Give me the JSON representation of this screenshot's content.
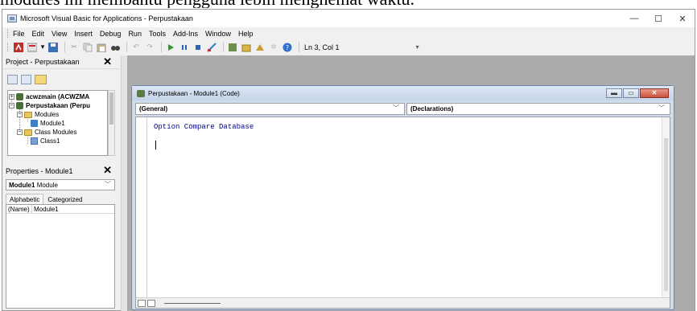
{
  "caption": "modules ini membantu pengguna lebih menghemat waktu.",
  "window": {
    "title": "Microsoft Visual Basic for Applications - Perpustakaan",
    "controls": {
      "minimize": "—",
      "maximize": "☐",
      "close": "✕"
    }
  },
  "menubar": {
    "items": [
      "File",
      "Edit",
      "View",
      "Insert",
      "Debug",
      "Run",
      "Tools",
      "Add-Ins",
      "Window",
      "Help"
    ]
  },
  "toolbar": {
    "position": "Ln 3, Col 1"
  },
  "project_panel": {
    "title": "Project - Perpustakaan",
    "close": "✕",
    "tree": [
      {
        "label": "acwzmain (ACWZMA",
        "bold": true
      },
      {
        "label": "Perpustakaan (Perpu",
        "bold": true
      },
      {
        "label": "Modules"
      },
      {
        "label": "Module1"
      },
      {
        "label": "Class Modules"
      },
      {
        "label": "Class1"
      }
    ]
  },
  "properties_panel": {
    "title": "Properties - Module1",
    "close": "✕",
    "object_name": "Module1",
    "object_type": "Module",
    "tabs": [
      "Alphabetic",
      "Categorized"
    ],
    "rows": [
      {
        "key": "(Name)",
        "value": "Module1"
      }
    ]
  },
  "code_window": {
    "title": "Perpustakaan - Module1 (Code)",
    "object_combo": "(General)",
    "procedure_combo": "(Declarations)",
    "code": "Option Compare Database"
  }
}
